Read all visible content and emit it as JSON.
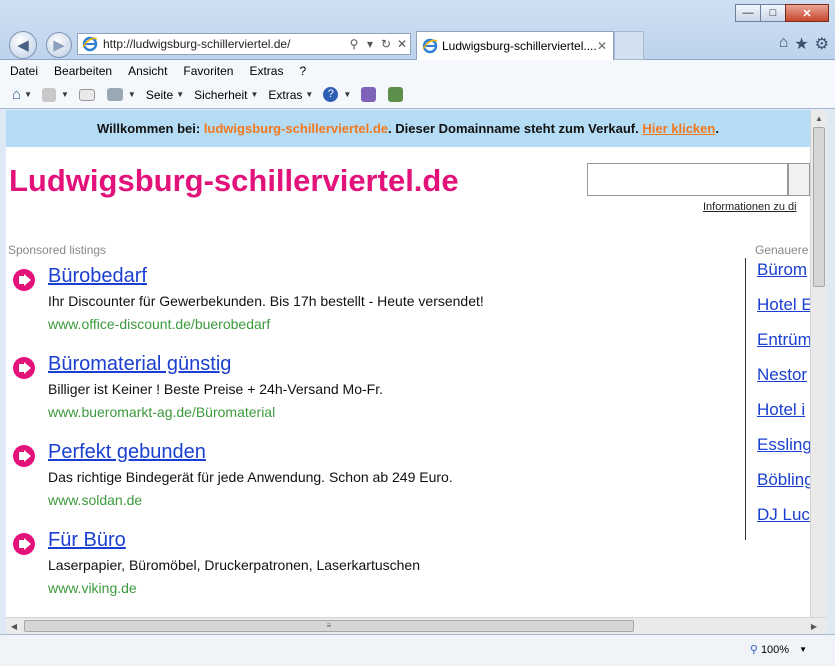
{
  "browser": {
    "address_url": "http://ludwigsburg-schillerviertel.de/",
    "tab_title": "Ludwigsburg-schillerviertel....",
    "menu": [
      "Datei",
      "Bearbeiten",
      "Ansicht",
      "Favoriten",
      "Extras",
      "?"
    ],
    "commands": {
      "page": "Seite",
      "security": "Sicherheit",
      "tools": "Extras"
    },
    "zoom": "100%"
  },
  "banner": {
    "prefix": "Willkommen bei: ",
    "domain": "ludwigsburg-schillerviertel.de",
    "middle": ". Dieser Domainname steht zum Verkauf. ",
    "link": "Hier klicken",
    "suffix": "."
  },
  "site": {
    "title": "Ludwigsburg-schillerviertel.de",
    "info_link": "Informationen zu di"
  },
  "sponsored_label": "Sponsored listings",
  "listings": [
    {
      "title": "Bürobedarf",
      "desc": "Ihr Discounter für Gewerbekunden. Bis 17h bestellt - Heute versendet!",
      "url": "www.office-discount.de/buerobedarf"
    },
    {
      "title": "Büromaterial günstig",
      "desc": "Billiger ist Keiner ! Beste Preise + 24h-Versand Mo-Fr.",
      "url": "www.bueromarkt-ag.de/Büromaterial"
    },
    {
      "title": "Perfekt gebunden",
      "desc": "Das richtige Bindegerät für jede Anwendung. Schon ab 249 Euro.",
      "url": "www.soldan.de"
    },
    {
      "title": "Für Büro",
      "desc": "Laserpapier, Büromöbel, Druckerpatronen, Laserkartuschen",
      "url": "www.viking.de"
    }
  ],
  "related_label": "Genauere",
  "related": [
    "Bürom",
    "Hotel E",
    "Entrüm",
    "Nestor",
    "Hotel i",
    "Essling",
    "Böbling",
    "DJ Luc"
  ]
}
